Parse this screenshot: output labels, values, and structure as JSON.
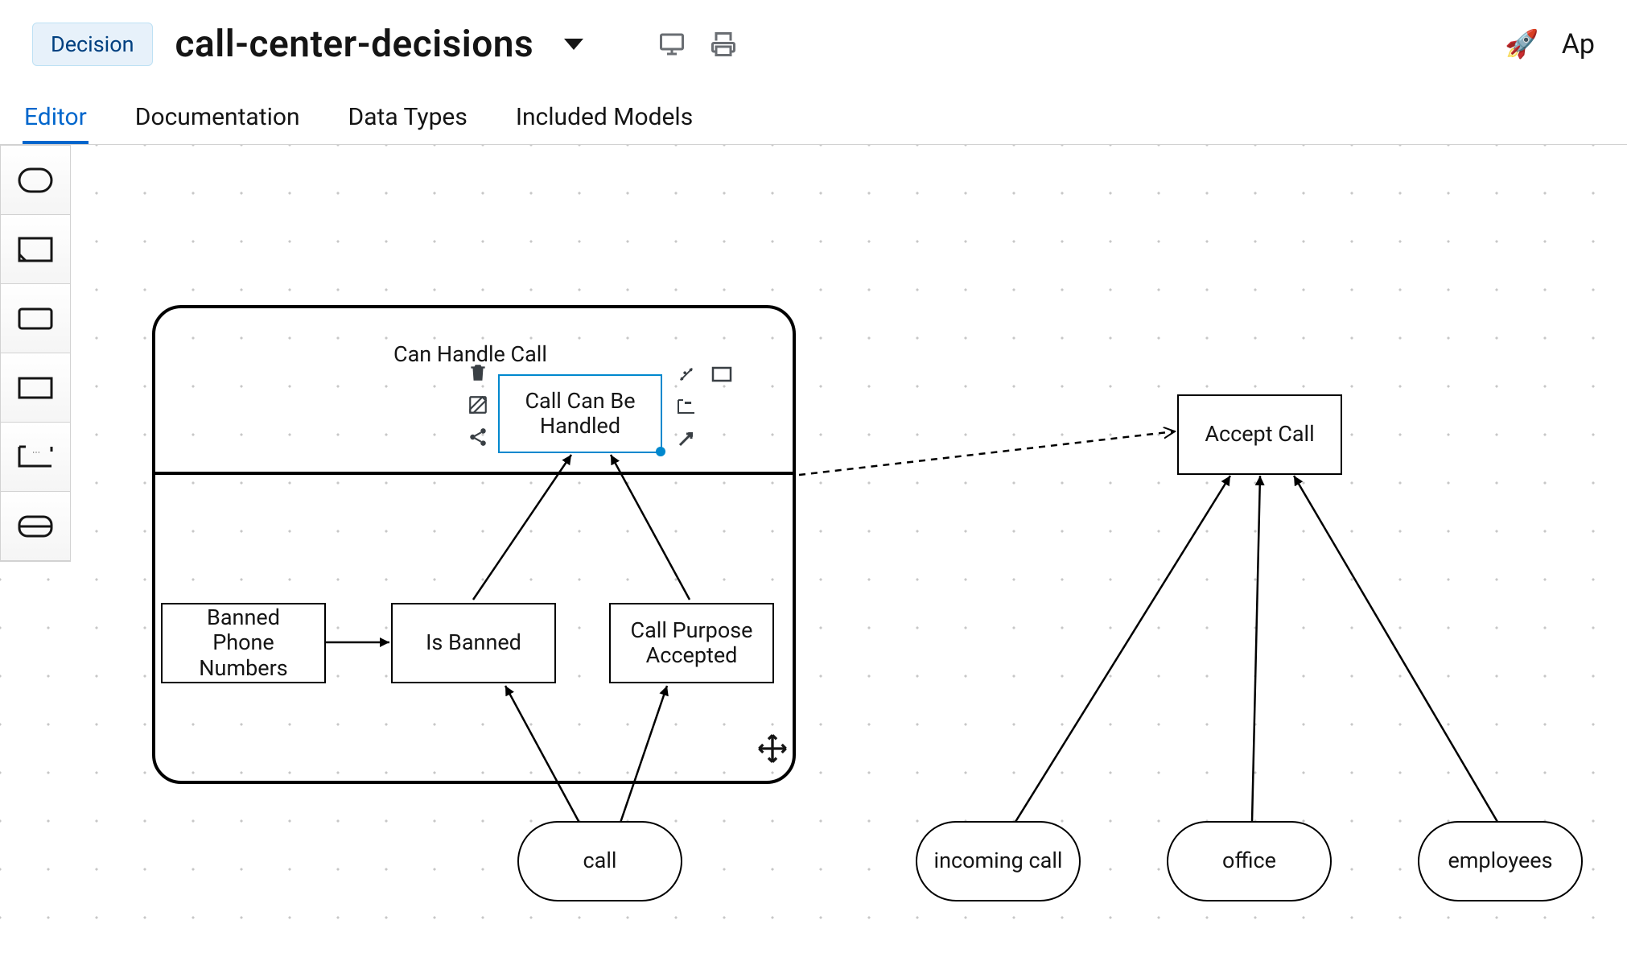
{
  "header": {
    "badge": "Decision",
    "title": "call-center-decisions",
    "apLabel": "Ap"
  },
  "tabs": {
    "editor": "Editor",
    "documentation": "Documentation",
    "dataTypes": "Data Types",
    "includedModels": "Included Models"
  },
  "palette": {
    "items": [
      {
        "name": "decision-service-shape"
      },
      {
        "name": "annotation-shape"
      },
      {
        "name": "decision-shape"
      },
      {
        "name": "bkm-shape"
      },
      {
        "name": "group-shape"
      },
      {
        "name": "input-data-shape"
      }
    ]
  },
  "diagram": {
    "group": {
      "title": "Can Handle Call"
    },
    "nodes": {
      "callCanBeHandled": "Call Can Be\nHandled",
      "bannedPhoneNumbers": "Banned\nPhone\nNumbers",
      "isBanned": "Is Banned",
      "callPurposeAccepted": "Call Purpose\nAccepted",
      "acceptCall": "Accept Call",
      "call": "call",
      "incomingCall": "incoming call",
      "office": "office",
      "employees": "employees"
    }
  },
  "contextToolbar": {
    "left": [
      "trash-icon",
      "edit-icon",
      "share-icon"
    ],
    "rightTop": [
      "sparkle-icon",
      "rect-icon"
    ],
    "rightBottom": [
      "group-icon",
      "arrow-up-right-icon"
    ]
  }
}
